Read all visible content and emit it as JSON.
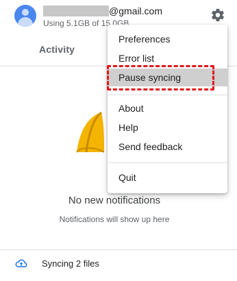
{
  "header": {
    "email_domain": "@gmail.com",
    "storage_text": "Using 5.1GB of 15.0GB"
  },
  "tabs": {
    "activity_label": "Activity"
  },
  "empty_state": {
    "title": "No new notifications",
    "subtitle": "Notifications will show up here"
  },
  "footer": {
    "sync_label": "Syncing 2 files"
  },
  "menu": {
    "preferences": "Preferences",
    "error_list": "Error list",
    "pause_syncing": "Pause syncing",
    "about": "About",
    "help": "Help",
    "send_feedback": "Send feedback",
    "quit": "Quit"
  },
  "colors": {
    "accent": "#1a73e8",
    "highlight_outline": "#e0161b",
    "bell": "#f4b400"
  }
}
